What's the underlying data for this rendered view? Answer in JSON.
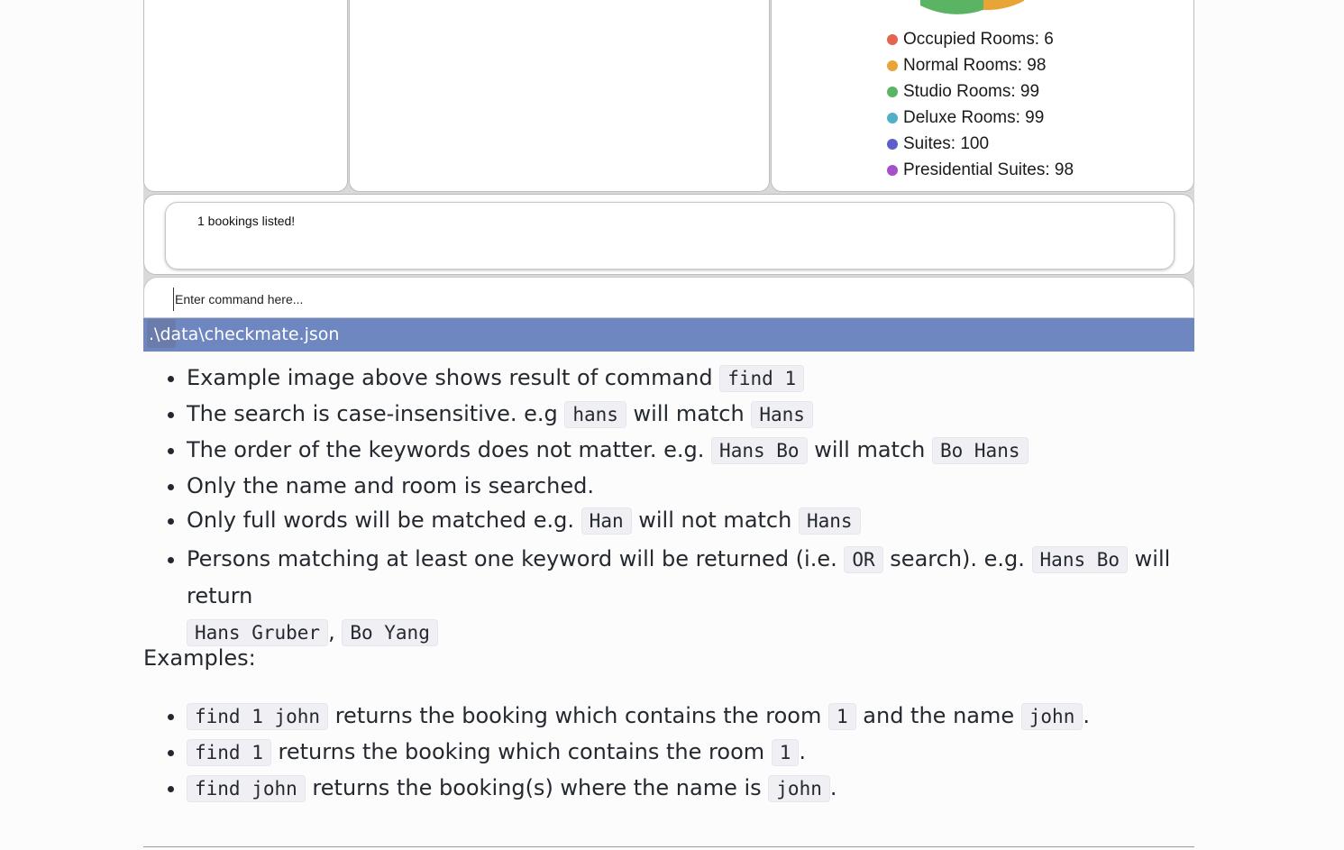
{
  "pie_chart": {
    "legend": [
      {
        "label": "Occupied Rooms: 6",
        "color": "#e2664f"
      },
      {
        "label": "Normal Rooms: 98",
        "color": "#e9a437"
      },
      {
        "label": "Studio Rooms: 99",
        "color": "#5bb463"
      },
      {
        "label": "Deluxe Rooms: 99",
        "color": "#4fb0c6"
      },
      {
        "label": "Suites: 100",
        "color": "#5b5fc7"
      },
      {
        "label": "Presidential Suites: 98",
        "color": "#a550c8"
      }
    ]
  },
  "result_display": {
    "text": "1 bookings listed!"
  },
  "command_box": {
    "placeholder": "Enter command here..."
  },
  "status_bar": {
    "path": ".\\data\\checkmate.json",
    "icon": "app-icon"
  },
  "notes": {
    "b1": {
      "t1": "Example image above shows result of command ",
      "c1": "find 1"
    },
    "b2": {
      "t1": "The search is case-insensitive. e.g ",
      "c1": "hans",
      "t2": " will match ",
      "c2": "Hans"
    },
    "b3": {
      "t1": "The order of the keywords does not matter. e.g. ",
      "c1": "Hans Bo",
      "t2": " will match ",
      "c2": "Bo Hans"
    },
    "b4": {
      "t1": "Only the name and room is searched."
    },
    "b5": {
      "t1": "Only full words will be matched e.g. ",
      "c1": "Han",
      "t2": " will not match ",
      "c2": "Hans"
    },
    "b6": {
      "t1": "Persons matching at least one keyword will be returned (i.e. ",
      "c1": "OR",
      "t2": " search). e.g. ",
      "c2": "Hans Bo",
      "t3": " will return ",
      "c3": "Hans Gruber",
      "t4": ", ",
      "c4": "Bo Yang"
    }
  },
  "examples_label": "Examples:",
  "examples": {
    "e1": {
      "c1": "find 1 john",
      "t1": " returns the booking which contains the room ",
      "c2": "1",
      "t2": " and the name ",
      "c3": "john",
      "t3": "."
    },
    "e2": {
      "c1": "find 1",
      "t1": " returns the booking which contains the room ",
      "c2": "1",
      "t2": "."
    },
    "e3": {
      "c1": "find john",
      "t1": " returns the booking(s) where the name is ",
      "c2": "john",
      "t2": "."
    }
  }
}
